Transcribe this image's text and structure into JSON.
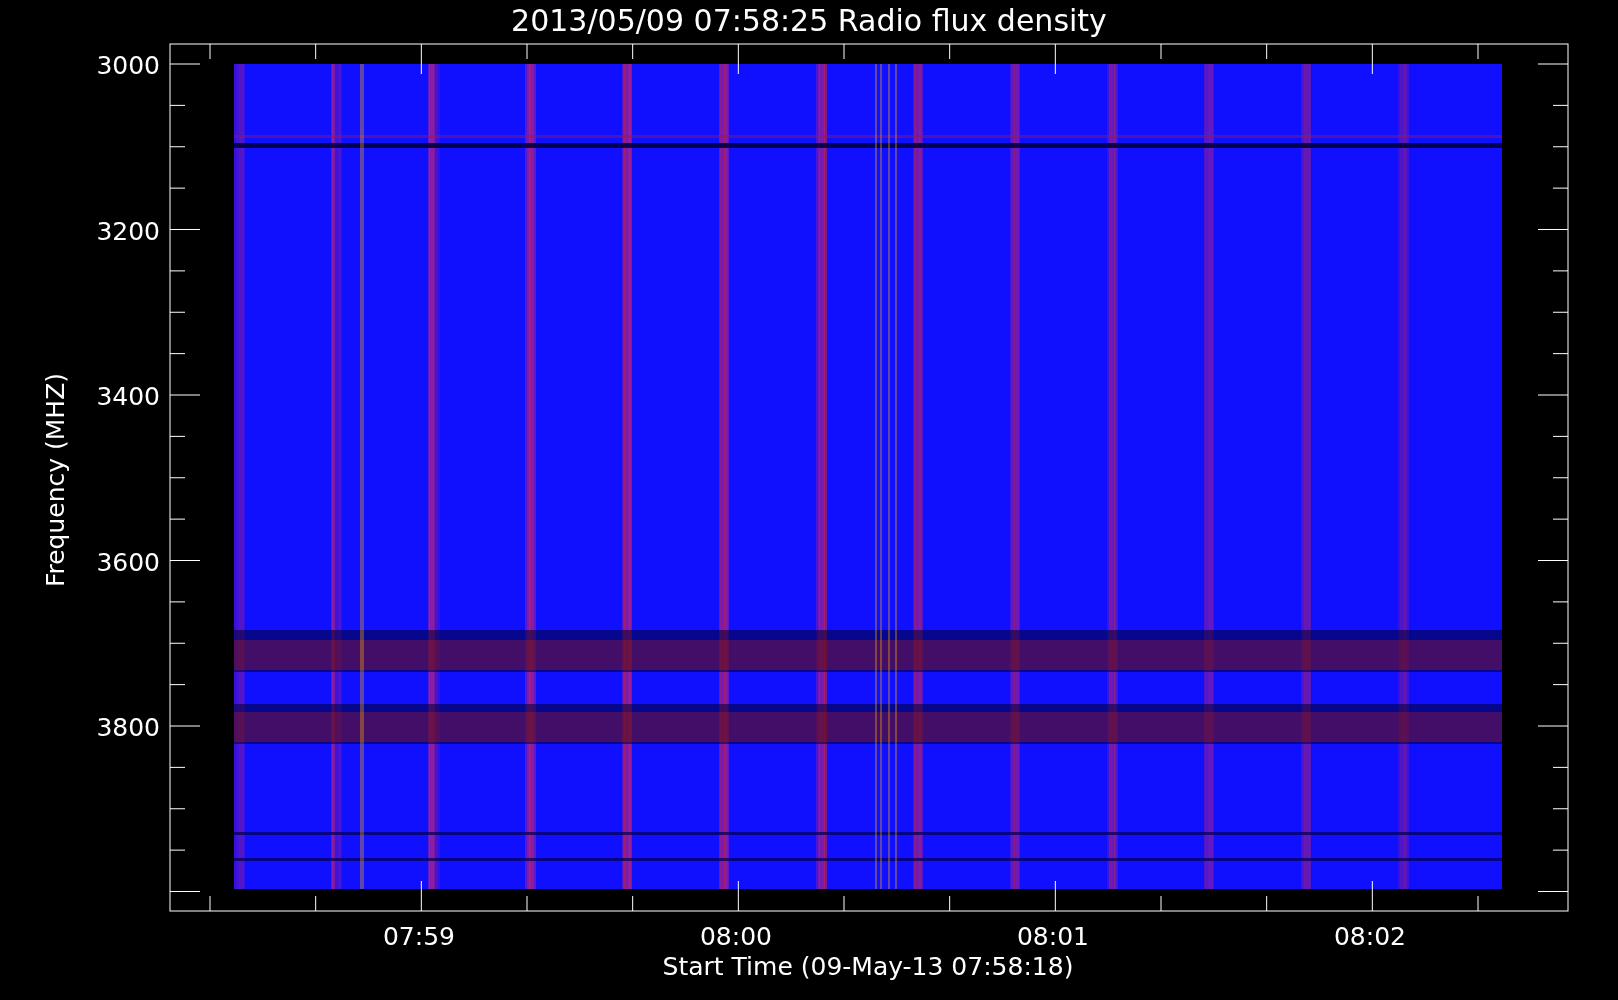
{
  "title": "2013/05/09 07:58:25 Radio flux density",
  "y_axis": {
    "label": "Frequency (MHZ)",
    "ticks": [
      "3000",
      "3200",
      "3400",
      "3600",
      "3800"
    ]
  },
  "x_axis": {
    "label": "Start Time (09-May-13 07:58:18)",
    "ticks": [
      "07:59",
      "08:00",
      "08:01",
      "08:02"
    ]
  }
}
